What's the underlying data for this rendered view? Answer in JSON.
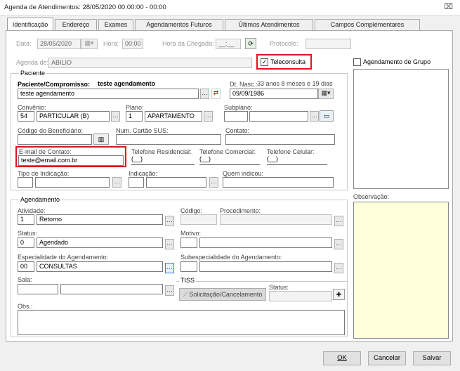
{
  "window": {
    "title": "Agenda de Atendimentos: 28/05/2020 00:00:00 - 00:00",
    "close_glyph": "⌧"
  },
  "tabs": [
    "Identificação",
    "Endereço",
    "Exames",
    "Agendamentos Futuros",
    "Últimos Atendimentos",
    "Campos Complementares"
  ],
  "top": {
    "data_label": "Data:",
    "data_value": "28/05/2020",
    "hora_label": "Hora:",
    "hora_value": "00:00",
    "chegada_label": "Hora da Chegada:",
    "chegada_value": "__:__",
    "protocolo_label": "Protocolo:",
    "agenda_label": "Agenda de:",
    "agenda_value": "ABILIO",
    "teleconsulta_label": "Teleconsulta",
    "teleconsulta_checked": true,
    "grupo_label": "Agendamento de Grupo",
    "grupo_checked": false
  },
  "paciente": {
    "group_title": "Paciente",
    "label": "Paciente/Compromisso:",
    "value_bold": "teste agendamento",
    "input_value": "teste agendamento",
    "nasc_label": "Dt. Nasc.:",
    "age": "33 anos 8 meses  e 19 dias",
    "nasc_value": "09/09/1986",
    "convenio_label": "Convênio:",
    "convenio_code": "54",
    "convenio_name": "PARTICULAR (B)",
    "plano_label": "Plano:",
    "plano_code": "1",
    "plano_name": "APARTAMENTO",
    "subplano_label": "Subplano:",
    "beneficiario_label": "Código do Beneficiário:",
    "sus_label": "Num. Cartão SUS:",
    "contato_label": "Contato:",
    "email_label": "E-mail de Contato:",
    "email_value": "teste@email.com.br",
    "tel_res_label": "Telefone Residencial:",
    "tel_com_label": "Telefone Comercial:",
    "tel_cel_label": "Telefone Celular:",
    "phone_mask": "(__)",
    "indicacao_tipo_label": "Tipo de Indicação:",
    "indicacao_label": "Indicação:",
    "quem_label": "Quem indicou:"
  },
  "agendamento": {
    "group_title": "Agendamento",
    "atividade_label": "Atividade:",
    "atividade_code": "1",
    "atividade_name": "Retorno",
    "codigo_label": "Código:",
    "procedimento_label": "Procedimento:",
    "status_label": "Status:",
    "status_code": "0",
    "status_name": "Agendado",
    "motivo_label": "Motivo:",
    "especialidade_label": "Especialidade do Agendamento:",
    "especialidade_code": "00",
    "especialidade_name": "CONSULTAS",
    "subesp_label": "Subespecialidade do Agendamento:",
    "sala_label": "Sala:",
    "tiss_label": "TISS",
    "tiss_status_label": "Status:",
    "tiss_button": "Solicitação/Cancelamento",
    "obs_label": "Obs.:"
  },
  "observacao_label": "Observação:",
  "footer": {
    "ok": "OK",
    "cancel": "Cancelar",
    "save": "Salvar"
  }
}
